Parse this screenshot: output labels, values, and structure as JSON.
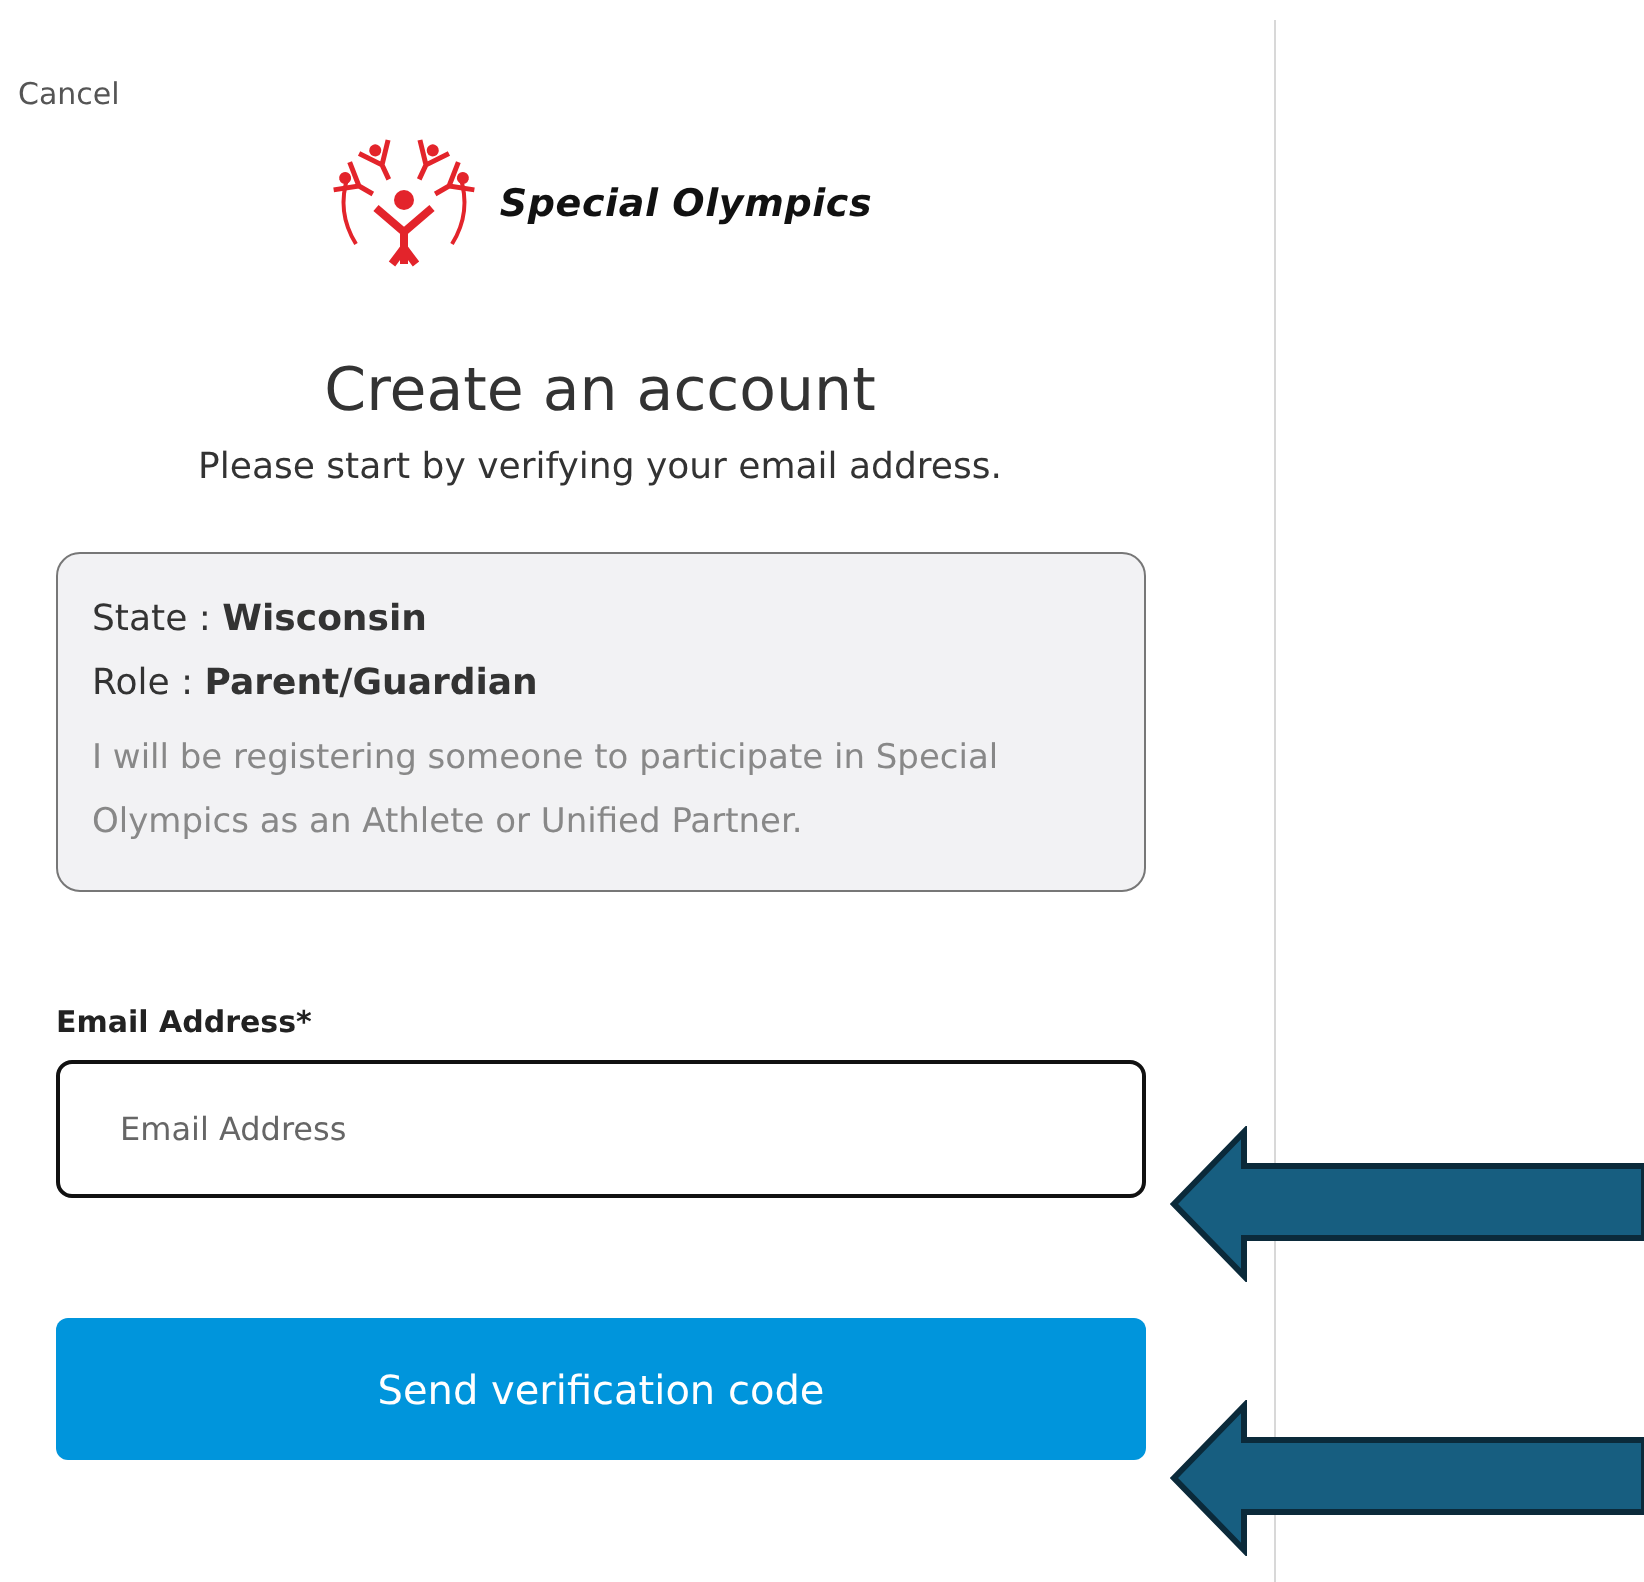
{
  "cancel_link": "Cancel",
  "logo": {
    "text": "Special Olympics"
  },
  "heading": "Create an account",
  "subheading": "Please start by verifying your email address.",
  "info_card": {
    "lines": [
      {
        "kind": "detail",
        "text": "State : **Wisconsin**"
      },
      {
        "kind": "detail",
        "text": "Role : **Parent/Guardian**"
      },
      {
        "kind": "note",
        "text": "I will be registering someone to participate in Special Olympics as an Athlete or Unified Partner."
      }
    ]
  },
  "email_field": {
    "label": "Email Address*",
    "placeholder": "Email Address"
  },
  "submit_button": "Send verification code"
}
